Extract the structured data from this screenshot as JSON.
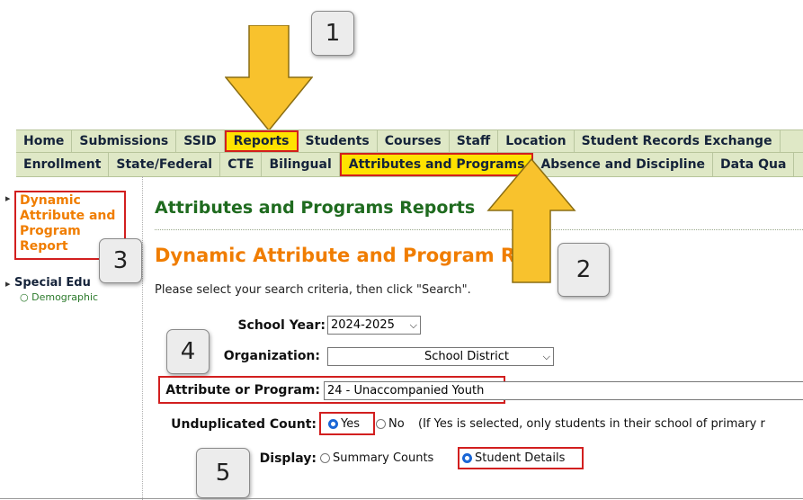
{
  "nav_primary": [
    "Home",
    "Submissions",
    "SSID",
    "Reports",
    "Students",
    "Courses",
    "Staff",
    "Location",
    "Student Records Exchange"
  ],
  "nav_secondary": [
    "Enrollment",
    "State/Federal",
    "CTE",
    "Bilingual",
    "Attributes and Programs",
    "Absence and Discipline",
    "Data Qua"
  ],
  "sidebar": {
    "active": [
      "Dynamic",
      "Attribute and",
      "Program",
      "Report"
    ],
    "item": "Special Edu",
    "subitem": "Demographic"
  },
  "main": {
    "heading": "Attributes and Programs Reports",
    "subheading": "Dynamic Attribute and Program Rep",
    "instructions": "Please select your search criteria, then click \"Search\"."
  },
  "form": {
    "school_year_label": "School Year:",
    "school_year_value": "2024-2025",
    "organization_label": "Organization:",
    "organization_value": "School District",
    "attribute_label": "Attribute or Program:",
    "attribute_value": "24 - Unaccompanied Youth",
    "unduplicated_label": "Unduplicated Count:",
    "unduplicated_yes": "Yes",
    "unduplicated_no": "No",
    "unduplicated_note": "(If Yes is selected, only students in their school of primary r",
    "display_label": "Display:",
    "display_summary": "Summary Counts",
    "display_details": "Student Details"
  },
  "callouts": [
    "1",
    "2",
    "3",
    "4",
    "5"
  ],
  "colors": {
    "highlight": "#ffe200",
    "annotation_red": "#d21f1f",
    "arrow": "#f8c22d",
    "nav_bg": "#dfe8c6"
  }
}
